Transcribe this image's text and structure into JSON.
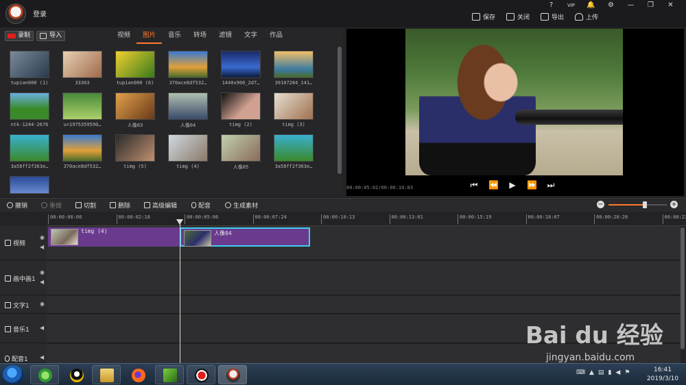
{
  "titlebar": {
    "login": "登录",
    "window_icons": [
      "?",
      "VIP",
      "🔔",
      "⚙",
      "—",
      "❐",
      "✕"
    ],
    "actions": [
      {
        "label": "保存",
        "icon": "save-icon"
      },
      {
        "label": "关闭",
        "icon": "close-project-icon"
      },
      {
        "label": "导出",
        "icon": "export-icon"
      },
      {
        "label": "上传",
        "icon": "upload-icon"
      }
    ]
  },
  "media": {
    "record_label": "录制",
    "import_label": "导入",
    "tabs": [
      "视频",
      "图片",
      "音乐",
      "转场",
      "滤镜",
      "文字",
      "作品"
    ],
    "active_tab": "图片",
    "items": [
      "tupian000 (1)",
      "33363",
      "tupian000 (6)",
      "370ace8df532…",
      "1440x900_2d7…",
      "39107284_141…",
      "ntk-1244-2676",
      "u=1975359590…",
      "人像03",
      "人像04",
      "timg (2)",
      "timg (3)",
      "3a58ff2f363e…",
      "370ace8df532…",
      "timg (5)",
      "timg (4)",
      "人像05",
      "3a58ff2f363e…",
      ""
    ]
  },
  "preview": {
    "timecode": "00:00:05:02/00:00:10:03",
    "controls": [
      "⏮",
      "⏪",
      "▶",
      "⏩",
      "⏭"
    ]
  },
  "toolbar": {
    "undo": "撤销",
    "redo": "重做",
    "cut": "切割",
    "delete": "删除",
    "advanced_edit": "高级编辑",
    "dub": "配音",
    "generate": "生成素材",
    "zoom_level": 0.62
  },
  "ruler": {
    "ticks": [
      "00:00:00:00",
      "00:00:02:18",
      "00:00:05:06",
      "00:00:07:24",
      "00:00:10:13",
      "00:00:13:01",
      "00:00:15:19",
      "00:00:18:07",
      "00:00:20:26",
      "00:00:23:"
    ]
  },
  "tracks": [
    {
      "name": "视频",
      "icon": "video-track-icon",
      "eye": true,
      "speaker": true
    },
    {
      "name": "画中画1",
      "icon": "pip-track-icon",
      "eye": true,
      "speaker": true
    },
    {
      "name": "文字1",
      "icon": "text-track-icon",
      "eye": true,
      "speaker": false
    },
    {
      "name": "音乐1",
      "icon": "music-track-icon",
      "eye": false,
      "speaker": true
    },
    {
      "name": "配音1",
      "icon": "mic-track-icon",
      "eye": false,
      "speaker": true
    }
  ],
  "clips": [
    {
      "label": "timg (4)",
      "selected": false
    },
    {
      "label": "人像04",
      "selected": true
    }
  ],
  "taskbar": {
    "clock_time": "16:41",
    "clock_date": "2019/3/10"
  },
  "watermark": {
    "brand": "Bai du 经验",
    "url": "jingyan.baidu.com"
  }
}
